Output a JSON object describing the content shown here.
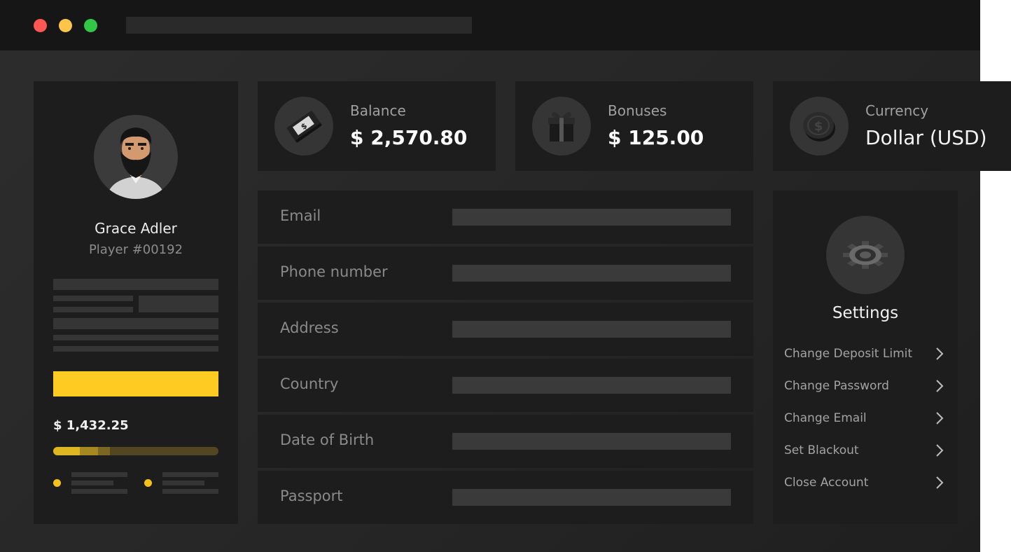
{
  "profile": {
    "name": "Grace Adler",
    "player_id": "Player  #00192",
    "amount": "$ 1,432.25",
    "progress": [
      0.16,
      0.11,
      0.07
    ]
  },
  "stats": {
    "balance": {
      "label": "Balance",
      "value": "$ 2,570.80",
      "icon": "money-icon"
    },
    "bonuses": {
      "label": "Bonuses",
      "value": "$ 125.00",
      "icon": "gift-icon"
    },
    "currency": {
      "label": "Currency",
      "value": "Dollar (USD)",
      "icon": "coin-icon"
    }
  },
  "form": {
    "email": "Email",
    "phone": "Phone number",
    "address": "Address",
    "country": "Country",
    "dob": "Date of Birth",
    "passport": "Passport"
  },
  "settings": {
    "title": "Settings",
    "items": [
      "Change Deposit Limit",
      "Change Password",
      "Change Email",
      "Set Blackout",
      "Close Account"
    ]
  },
  "colors": {
    "accent": "#fdcb22",
    "panel": "#1d1d1d",
    "background": "#2a2a2a"
  }
}
